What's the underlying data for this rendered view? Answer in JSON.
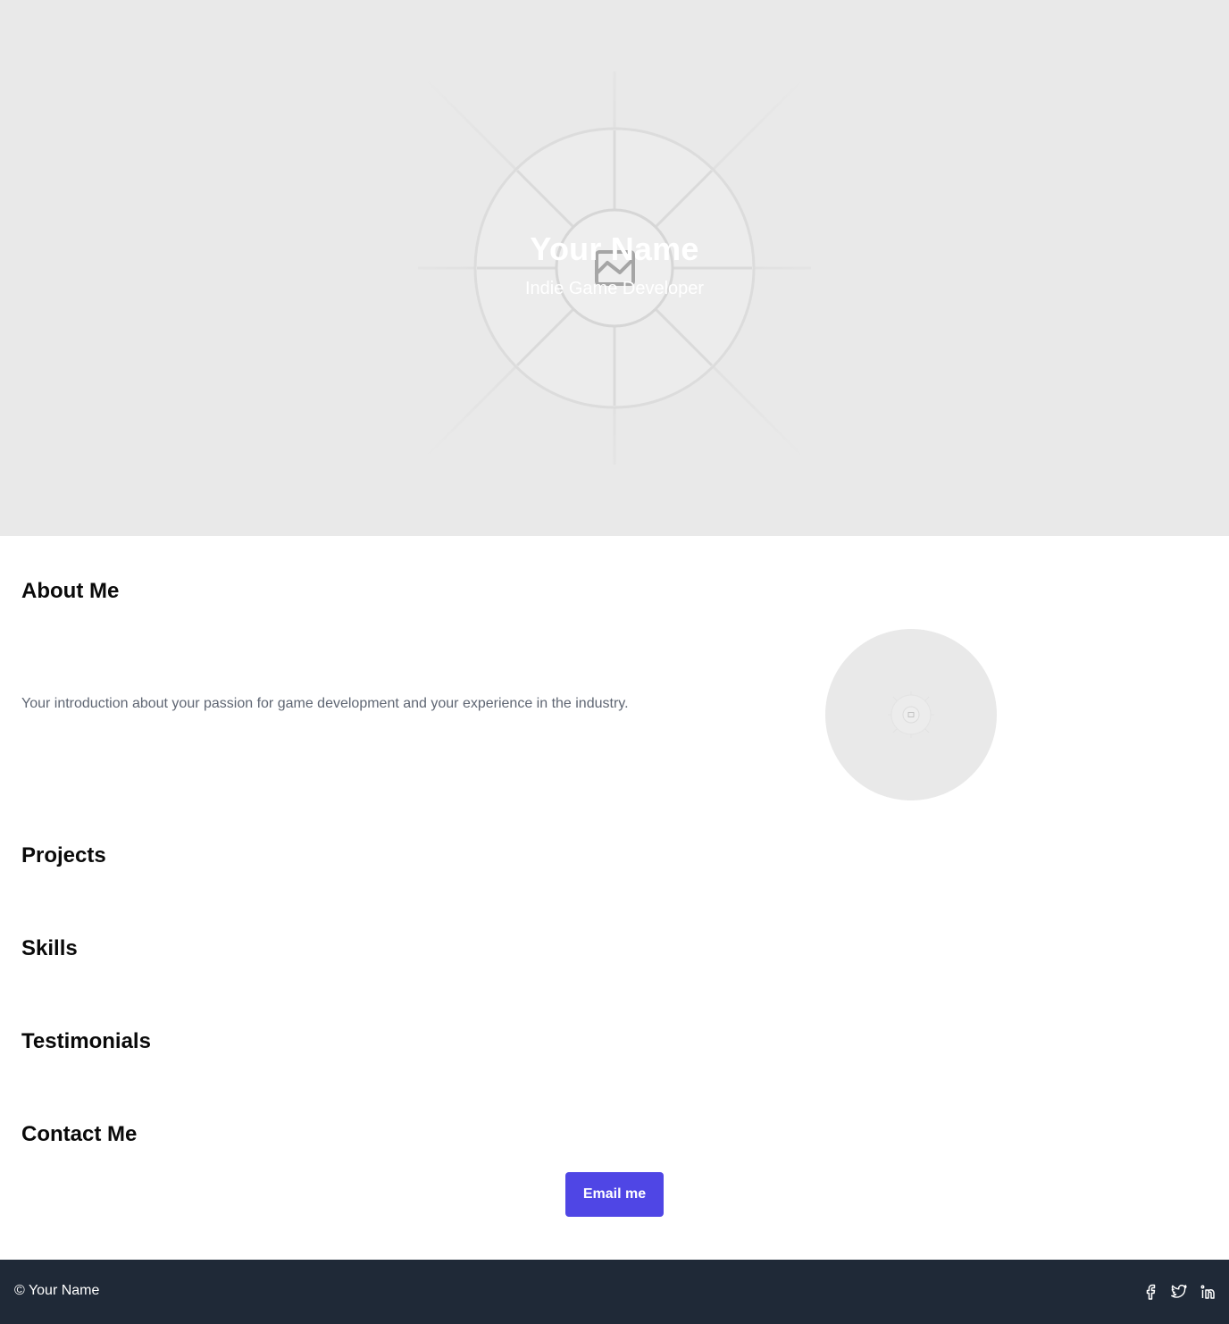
{
  "hero": {
    "title": "Your Name",
    "subtitle": "Indie Game Developer",
    "background_icon": "image-placeholder-icon"
  },
  "about": {
    "heading": "About Me",
    "text": "Your introduction about your passion for game development and your experience in the industry.",
    "image_icon": "image-placeholder-icon"
  },
  "projects": {
    "heading": "Projects"
  },
  "skills": {
    "heading": "Skills"
  },
  "testimonials": {
    "heading": "Testimonials"
  },
  "contact": {
    "heading": "Contact Me",
    "button_label": "Email me"
  },
  "footer": {
    "copyright": "© Your Name",
    "social_icons": [
      "facebook-icon",
      "twitter-icon",
      "linkedin-icon"
    ]
  },
  "colors": {
    "hero_bg": "#e9e9e9",
    "accent": "#4f46e5",
    "footer_bg": "#1f2937",
    "body_text": "#5f6673"
  }
}
